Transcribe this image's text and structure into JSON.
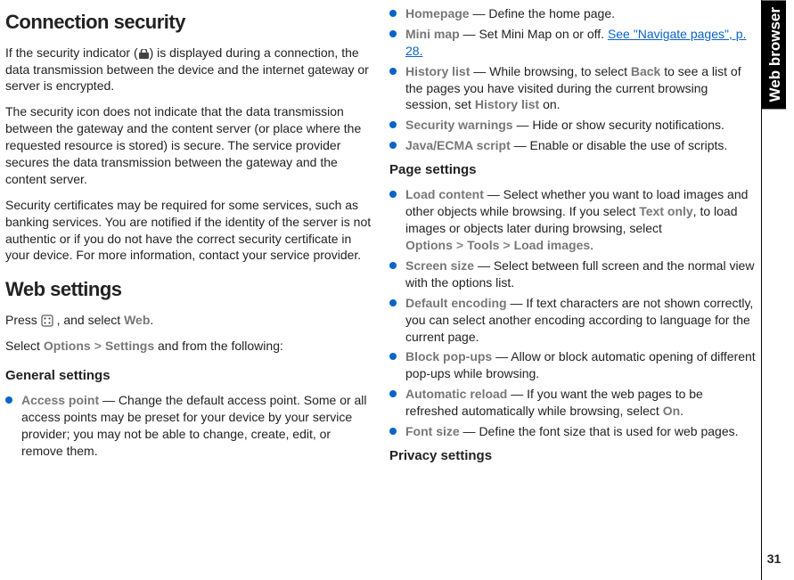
{
  "side": {
    "label": "Web browser",
    "page_num": "31"
  },
  "left": {
    "h1a": "Connection security",
    "p1a": "If the security indicator (",
    "p1b": ") is displayed during a connection, the data transmission between the device and the internet gateway or server is encrypted.",
    "p2": "The security icon does not indicate that the data transmission between the gateway and the content server (or place where the requested resource is stored) is secure. The service provider secures the data transmission between the gateway and the content server.",
    "p3": "Security certificates may be required for some services, such as banking services. You are notified if the identity of the server is not authentic or if you do not have the correct security certificate in your device. For more information, contact your service provider.",
    "h1b": "Web settings",
    "p4a": "Press ",
    "p4b": " , and select ",
    "p4c": "Web",
    "p4d": ".",
    "p5a": "Select ",
    "p5b": "Options",
    "p5c": "Settings",
    "p5d": " and from the following:",
    "sub1": "General settings",
    "li1_lead": "Access point",
    "li1_text": " — Change the default access point. Some or all access points may be preset for your device by your service provider; you may not be able to change, create, edit, or remove them."
  },
  "right": {
    "li2_lead": "Homepage",
    "li2_text": " — Define the home page.",
    "li3_lead": "Mini map",
    "li3_text_a": " — Set Mini Map on or off. ",
    "li3_link": "See \"Navigate pages\", p. 28.",
    "li4_lead": "History list",
    "li4_text_a": " — While browsing, to select ",
    "li4_back": "Back",
    "li4_text_b": " to see a list of the pages you have visited during the current browsing session, set ",
    "li4_hist": "History list",
    "li4_text_c": " on.",
    "li5_lead": "Security warnings",
    "li5_text": " — Hide or show security notifications.",
    "li6_lead": "Java/ECMA script",
    "li6_text": " — Enable or disable the use of scripts.",
    "sub2": "Page settings",
    "li7_lead": "Load content",
    "li7_text_a": " — Select whether you want to load images and other objects while browsing. If you select ",
    "li7_textonly": "Text only",
    "li7_text_b": ", to load images or objects later during browsing, select ",
    "li7_options": "Options",
    "li7_tools": "Tools",
    "li7_load": "Load images",
    "li7_dot": ".",
    "li8_lead": "Screen size",
    "li8_text": " — Select between full screen and the normal view with the options list.",
    "li9_lead": "Default encoding",
    "li9_text": " — If text characters are not shown correctly, you can select another encoding according to language for the current page.",
    "li10_lead": "Block pop-ups",
    "li10_text": " — Allow or block automatic opening of different pop-ups while browsing.",
    "li11_lead": "Automatic reload",
    "li11_text_a": " — If you want the web pages to be refreshed automatically while browsing, select ",
    "li11_on": "On",
    "li11_dot": ".",
    "li12_lead": "Font size",
    "li12_text": " — Define the font size that is used for web pages.",
    "sub3": "Privacy settings"
  }
}
